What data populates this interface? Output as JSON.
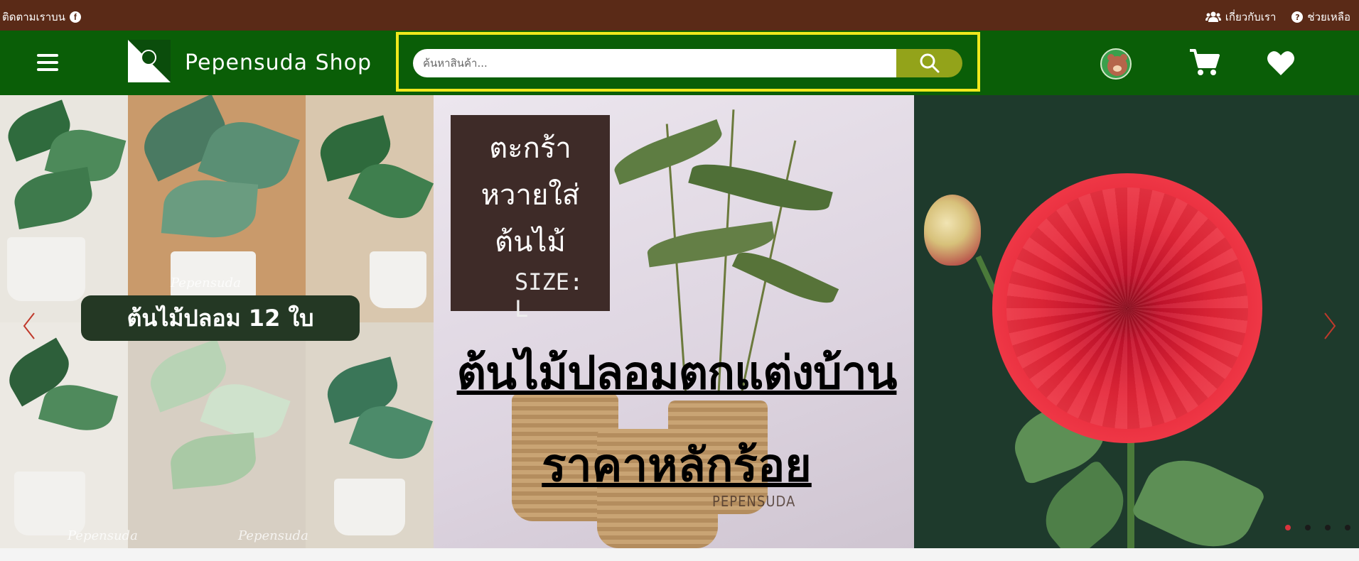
{
  "topbar": {
    "follow_text": "ติดตามเราบน",
    "facebook_icon": "facebook-icon",
    "about_label": "เกี่ยวกับเรา",
    "about_icon": "users-icon",
    "help_label": "ช่วยเหลือ",
    "help_icon": "question-circle-icon"
  },
  "header": {
    "shop_name": "Pepensuda Shop",
    "search_placeholder": "ค้นหาสินค้า...",
    "search_value": "",
    "icons": [
      "menu-icon",
      "search-icon",
      "avatar",
      "cart-icon",
      "heart-icon"
    ]
  },
  "carousel": {
    "slide_left": {
      "label": "ต้นไม้ปลอม 12 ใบ",
      "watermark": "Pepensuda"
    },
    "slide_mid": {
      "sign_lines": [
        "ตะกร้า",
        "หวายใส่",
        "ต้นไม้"
      ],
      "sign_size": "SIZE: L",
      "headline_1": "ต้นไม้ปลอมตกแต่งบ้าน",
      "headline_2": "ราคาหลักร้อย",
      "watermark": "PEPENSUDA"
    },
    "dots_count": 4,
    "active_dot": 0
  },
  "colors": {
    "topbar_bg": "#5a2a17",
    "header_bg": "#0a5e07",
    "search_highlight": "#f0e81c",
    "search_button": "#93a31a",
    "active_dot": "#d9333d"
  }
}
